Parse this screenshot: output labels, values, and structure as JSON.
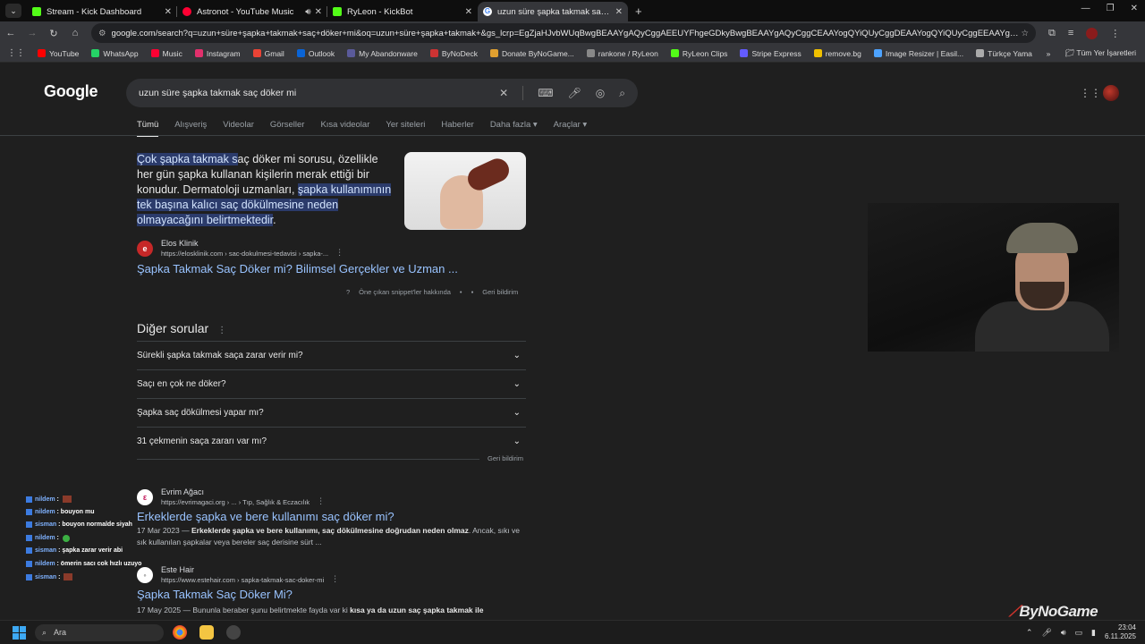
{
  "browser": {
    "tabs": [
      {
        "title": "Stream - Kick Dashboard",
        "color": "#53fc18"
      },
      {
        "title": "Astronot - YouTube Music",
        "color": "#ff0033",
        "audio": true
      },
      {
        "title": "RyLeon - KickBot",
        "color": "#53fc18"
      },
      {
        "title": "uzun süre şapka takmak saç d...",
        "color": "#4285f4",
        "active": true
      }
    ],
    "url": "google.com/search?q=uzun+süre+şapka+takmak+saç+döker+mi&oq=uzun+süre+şapka+takmak+&gs_lcrp=EgZjaHJvbWUqBwgBEAAYgAQyCggAEEUYFhgeGDkyBwgBEAAYgAQyCggCEAAYogQYiQUyCggDEAAYogQYiQUyCggEEAAYgAQYogQy...",
    "bookmarks": [
      {
        "label": "YouTube",
        "color": "#ff0000"
      },
      {
        "label": "WhatsApp",
        "color": "#25d366"
      },
      {
        "label": "Music",
        "color": "#ff0033"
      },
      {
        "label": "Instagram",
        "color": "#e1306c"
      },
      {
        "label": "Gmail",
        "color": "#ea4335"
      },
      {
        "label": "Outlook",
        "color": "#0a64d6"
      },
      {
        "label": "My Abandonware",
        "color": "#5a5a9a"
      },
      {
        "label": "ByNoDeck",
        "color": "#cc3333"
      },
      {
        "label": "Donate ByNoGame...",
        "color": "#e0a030"
      },
      {
        "label": "rankone / RyLeon",
        "color": "#888888"
      },
      {
        "label": "RyLeon Clips",
        "color": "#53fc18"
      },
      {
        "label": "Stripe Express",
        "color": "#635bff"
      },
      {
        "label": "remove.bg",
        "color": "#f0c000"
      },
      {
        "label": "Image Resizer | Easil...",
        "color": "#4da3ff"
      },
      {
        "label": "Türkçe Yama",
        "color": "#aaaaaa"
      }
    ],
    "all_bookmarks": "Tüm Yer İşaretleri"
  },
  "google": {
    "logo": "Google",
    "query": "uzun süre şapka takmak saç döker mi",
    "nav_tabs": [
      "Tümü",
      "Alışveriş",
      "Videolar",
      "Görseller",
      "Kısa videolar",
      "Yer siteleri",
      "Haberler",
      "Daha fazla ▾",
      "Araçlar ▾"
    ],
    "snippet": {
      "hl1": "Çok şapka takmak s",
      "t1": "aç döker mi sorusu, özellikle her gün şapka kullanan kişilerin merak ettiği bir konudur. Dermatoloji uzmanları, ",
      "hl2": "şapka kullanımının tek başına kalıcı saç dökülmesine neden olmayacağını belirtmektedir",
      "t2": "."
    },
    "featured": {
      "site": "Elos Klinik",
      "url": "https://elosklinik.com › sac-dokulmesi-tedavisi › sapka-...",
      "title": "Şapka Takmak Saç Döker mi? Bilimsel Gerçekler ve Uzman ...",
      "about": "Öne çıkan snippet'ler hakkında",
      "feedback": "Geri bildirim"
    },
    "questions_header": "Diğer sorular",
    "questions": [
      "Sürekli şapka takmak saça zarar verir mi?",
      "Saçı en çok ne döker?",
      "Şapka saç dökülmesi yapar mı?",
      "31 çekmenin saça zararı var mı?"
    ],
    "questions_feedback": "Geri bildirim",
    "results": [
      {
        "site": "Evrim Ağacı",
        "url": "https://evrimagaci.org › ... › Tıp, Sağlık & Eczacılık",
        "title": "Erkeklerde şapka ve bere kullanımı saç döker mi?",
        "date": "17 Mar 2023 —",
        "desc_b": "Erkeklerde şapka ve bere kullanımı, saç dökülmesine doğrudan neden olmaz",
        "desc_t": ". Ancak, sıkı ve sık kullanılan şapkalar veya bereler saç derisine sürt ..."
      },
      {
        "site": "Este Hair",
        "url": "https://www.estehair.com › sapka-takmak-sac-doker-mi",
        "title": "Şapka Takmak Saç Döker Mi?",
        "date": "17 May 2025 —",
        "desc_t": "Bununla beraber şunu belirtmekte fayda var ki ",
        "desc_b": "kısa ya da uzun saç şapka takmak ile"
      }
    ]
  },
  "chat": [
    {
      "user": "nildem",
      "msg": ""
    },
    {
      "user": "nildem",
      "msg": "bouyon mu"
    },
    {
      "user": "sisman",
      "msg": "bouyon normalde siyah"
    },
    {
      "user": "nildem",
      "msg": ""
    },
    {
      "user": "sisman",
      "msg": "şapka zarar verir abi"
    },
    {
      "user": "nildem",
      "msg": "ömerin sacı cok hızlı uzuyo"
    },
    {
      "user": "sisman",
      "msg": ""
    }
  ],
  "watermark": "ByNoGame",
  "taskbar": {
    "search": "Ara",
    "time": "23:04",
    "date": "6.11.2025"
  }
}
